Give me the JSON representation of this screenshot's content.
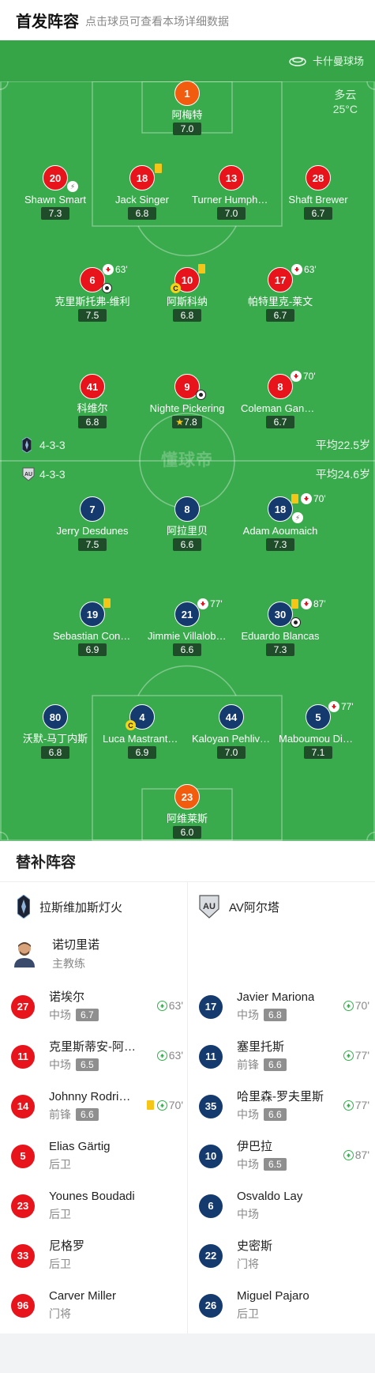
{
  "header": {
    "title": "首发阵容",
    "hint": "点击球员可查看本场详细数据"
  },
  "stadium": {
    "name": "卡什曼球场",
    "icon": "stadium-icon"
  },
  "weather": {
    "condition": "多云",
    "temperature": "25°C"
  },
  "watermark": "懂球帝",
  "home_team": {
    "name": "拉斯维加斯灯火",
    "formation": "4-3-3",
    "avg_age": "平均22.5岁",
    "color": "#e8141b"
  },
  "away_team": {
    "name": "AV阿尔塔",
    "formation": "4-3-3",
    "avg_age": "平均24.6岁",
    "color": "#153a6e"
  },
  "home_players": [
    {
      "number": "1",
      "name": "阿梅特",
      "rating": "7.0",
      "events": []
    },
    {
      "number": "20",
      "name": "Shawn Smart",
      "rating": "7.3",
      "events": [
        "assist"
      ]
    },
    {
      "number": "18",
      "name": "Jack Singer",
      "rating": "6.8",
      "events": [
        "yellow-card"
      ]
    },
    {
      "number": "13",
      "name": "Turner Humphrey",
      "rating": "7.0",
      "events": []
    },
    {
      "number": "28",
      "name": "Shaft Brewer",
      "rating": "6.7",
      "events": []
    },
    {
      "number": "6",
      "name": "克里斯托弗-维利",
      "rating": "7.5",
      "events": [
        "sub-off",
        "goal"
      ],
      "sub_minute": "63'"
    },
    {
      "number": "10",
      "name": "阿斯科纳",
      "rating": "6.8",
      "events": [
        "yellow-card",
        "captain"
      ]
    },
    {
      "number": "17",
      "name": "帕特里克-莱文",
      "rating": "6.7",
      "events": [
        "sub-off"
      ],
      "sub_minute": "63'"
    },
    {
      "number": "41",
      "name": "科维尔",
      "rating": "6.8",
      "events": []
    },
    {
      "number": "9",
      "name": "Nighte Pickering",
      "rating": "7.8",
      "events": [
        "goal",
        "mvp"
      ]
    },
    {
      "number": "8",
      "name": "Coleman Gannon",
      "rating": "6.7",
      "events": [
        "sub-off"
      ],
      "sub_minute": "70'"
    }
  ],
  "away_players": [
    {
      "number": "7",
      "name": "Jerry Desdunes",
      "rating": "7.5",
      "events": []
    },
    {
      "number": "8",
      "name": "阿拉里贝",
      "rating": "6.6",
      "events": []
    },
    {
      "number": "18",
      "name": "Adam Aoumaich",
      "rating": "7.3",
      "events": [
        "yellow-card",
        "sub-off",
        "assist"
      ],
      "sub_minute": "70'"
    },
    {
      "number": "19",
      "name": "Sebastian Contreras",
      "rating": "6.9",
      "events": [
        "yellow-card"
      ]
    },
    {
      "number": "21",
      "name": "Jimmie Villalobos",
      "rating": "6.6",
      "events": [
        "sub-off"
      ],
      "sub_minute": "77'"
    },
    {
      "number": "30",
      "name": "Eduardo Blancas",
      "rating": "7.3",
      "events": [
        "yellow-card",
        "sub-off",
        "goal"
      ],
      "sub_minute": "87'"
    },
    {
      "number": "80",
      "name": "沃默-马丁内斯",
      "rating": "6.8",
      "events": []
    },
    {
      "number": "4",
      "name": "Luca Mastrantonio",
      "rating": "6.9",
      "events": [
        "captain"
      ]
    },
    {
      "number": "44",
      "name": "Kaloyan Pehlivanov",
      "rating": "7.0",
      "events": []
    },
    {
      "number": "5",
      "name": "Maboumou Diallo",
      "rating": "7.1",
      "events": [
        "sub-off"
      ],
      "sub_minute": "77'"
    },
    {
      "number": "23",
      "name": "阿维莱斯",
      "rating": "6.0",
      "events": []
    }
  ],
  "subs": {
    "title": "替补阵容",
    "coach": {
      "name": "诺切里诺",
      "role": "主教练"
    },
    "home": [
      {
        "number": "27",
        "name": "诺埃尔",
        "position": "中场",
        "rating": "6.7",
        "minute": "63'"
      },
      {
        "number": "11",
        "name": "克里斯蒂安-阿科斯",
        "position": "中场",
        "rating": "6.5",
        "minute": "63'"
      },
      {
        "number": "14",
        "name": "Johnny Rodriguez",
        "position": "前锋",
        "rating": "6.6",
        "minute": "70'",
        "yellow": true
      },
      {
        "number": "5",
        "name": "Elias Gärtig",
        "position": "后卫"
      },
      {
        "number": "23",
        "name": "Younes Boudadi",
        "position": "后卫"
      },
      {
        "number": "33",
        "name": "尼格罗",
        "position": "后卫"
      },
      {
        "number": "96",
        "name": "Carver Miller",
        "position": "门将"
      }
    ],
    "away": [
      {
        "number": "17",
        "name": "Javier Mariona",
        "position": "中场",
        "rating": "6.8",
        "minute": "70'"
      },
      {
        "number": "11",
        "name": "塞里托斯",
        "position": "前锋",
        "rating": "6.6",
        "minute": "77'"
      },
      {
        "number": "35",
        "name": "哈里森-罗夫里斯",
        "position": "中场",
        "rating": "6.6",
        "minute": "77'"
      },
      {
        "number": "10",
        "name": "伊巴拉",
        "position": "中场",
        "rating": "6.5",
        "minute": "87'"
      },
      {
        "number": "6",
        "name": "Osvaldo Lay",
        "position": "中场"
      },
      {
        "number": "22",
        "name": "史密斯",
        "position": "门将"
      },
      {
        "number": "26",
        "name": "Miguel Pajaro",
        "position": "后卫"
      }
    ]
  }
}
